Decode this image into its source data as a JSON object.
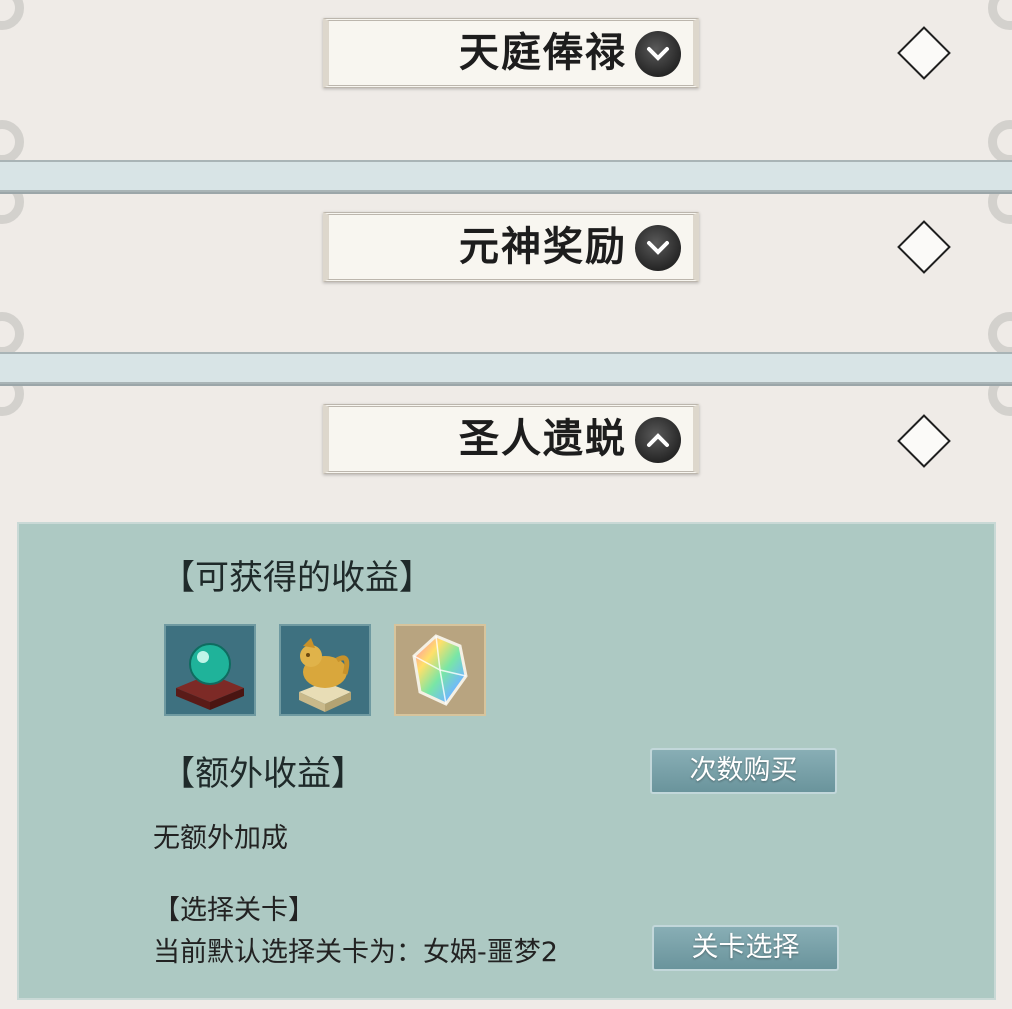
{
  "sections": [
    {
      "title": "天庭俸禄",
      "chevron": "chevron-down-icon"
    },
    {
      "title": "元神奖励",
      "chevron": "chevron-down-icon"
    },
    {
      "title": "圣人遗蜕",
      "chevron": "chevron-up-icon"
    }
  ],
  "panel": {
    "rewards_header": "【可获得的收益】",
    "reward_icons": [
      "jade-orb-icon",
      "golden-beast-seal-icon",
      "rainbow-crystal-icon"
    ],
    "extra_header": "【额外收益】",
    "buy_button": "次数购买",
    "extra_text": "无额外加成",
    "stage_header": "【选择关卡】",
    "stage_text": "当前默认选择关卡为：女娲-噩梦2",
    "stage_button": "关卡选择"
  },
  "colors": {
    "panel_bg": "#adc9c3",
    "button_bg": "#7aa3ab",
    "page_bg": "#efebe7"
  }
}
